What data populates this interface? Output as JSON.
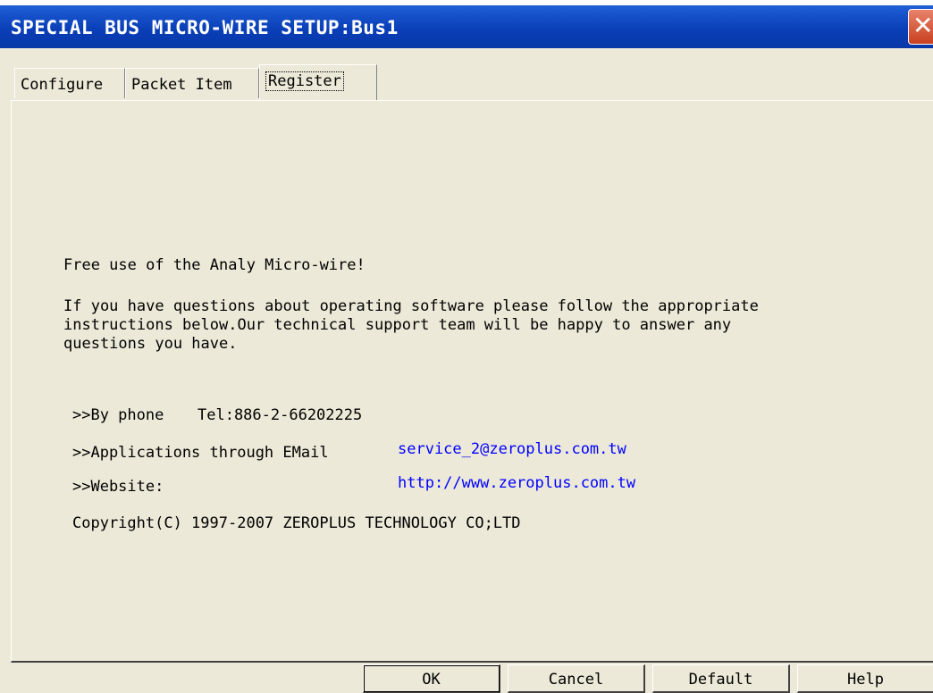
{
  "window": {
    "title": "SPECIAL BUS MICRO-WIRE SETUP:Bus1"
  },
  "tabs": [
    {
      "label": "Configure"
    },
    {
      "label": "Packet Item"
    },
    {
      "label": "Register"
    }
  ],
  "register": {
    "free_use": "Free use of the Analy Micro-wire!",
    "questions_line1": "If you have questions about operating software please follow the appropriate",
    "questions_line2": "instructions below.Our technical support team will be happy to answer any",
    "questions_line3": "questions you have.",
    "phone_label": ">>By phone",
    "phone_value": "Tel:886-2-66202225",
    "email_label": ">>Applications through EMail",
    "email_value": "service_2@zeroplus.com.tw",
    "website_label": ">>Website:",
    "website_value": "http://www.zeroplus.com.tw",
    "copyright": "Copyright(C) 1997-2007 ZEROPLUS TECHNOLOGY CO;LTD"
  },
  "buttons": {
    "ok": "OK",
    "cancel": "Cancel",
    "default": "Default",
    "help": "Help"
  }
}
